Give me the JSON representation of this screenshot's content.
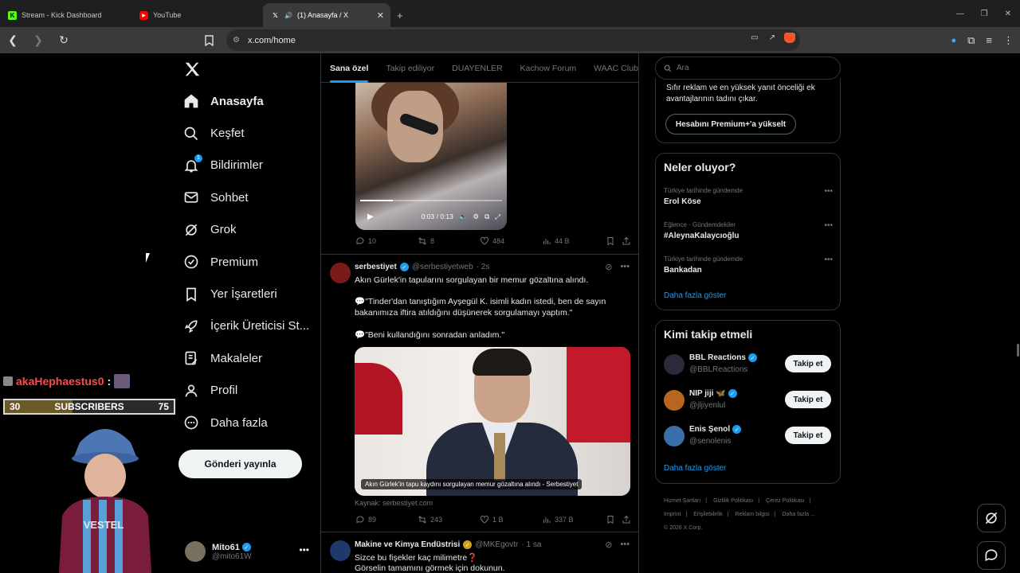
{
  "browser": {
    "tabs": [
      {
        "title": "Stream - Kick Dashboard",
        "icon": "kick-icon",
        "color": "#53fc18"
      },
      {
        "title": "YouTube",
        "icon": "youtube-icon",
        "color": "#ff0000"
      },
      {
        "title": "(1) Anasayfa / X",
        "icon": "x-icon",
        "color": "#ffffff",
        "active": true
      }
    ],
    "new_tab": "+",
    "url": "x.com/home"
  },
  "overlay": {
    "chat_user": "akaHephaestus0",
    "chat_colon": ":",
    "sub_current": "30",
    "sub_label": "SUBSCRIBERS",
    "sub_goal": "75",
    "sub_fraction": 0.4
  },
  "nav": {
    "items": [
      {
        "label": "Anasayfa",
        "icon": "home-icon",
        "active": true
      },
      {
        "label": "Keşfet",
        "icon": "search-icon"
      },
      {
        "label": "Bildirimler",
        "icon": "bell-icon",
        "badge": "1"
      },
      {
        "label": "Sohbet",
        "icon": "mail-icon"
      },
      {
        "label": "Grok",
        "icon": "grok-icon"
      },
      {
        "label": "Premium",
        "icon": "premium-icon"
      },
      {
        "label": "Yer İşaretleri",
        "icon": "bookmark-icon"
      },
      {
        "label": "İçerik Üreticisi St...",
        "icon": "rocket-icon"
      },
      {
        "label": "Makaleler",
        "icon": "article-icon"
      },
      {
        "label": "Profil",
        "icon": "person-icon"
      },
      {
        "label": "Daha fazla",
        "icon": "more-circle-icon"
      }
    ],
    "post_button": "Gönderi yayınla",
    "me": {
      "name": "Mito61",
      "handle": "@mito61W"
    }
  },
  "feed": {
    "tabs": [
      "Sana özel",
      "Takip ediliyor",
      "DUAYENLER",
      "Kachow Forum",
      "WAAC Club"
    ],
    "video": {
      "time": "0:03 / 0:13",
      "progress": 0.23
    },
    "video_actions": {
      "replies": "10",
      "reposts": "8",
      "likes": "484",
      "views": "44 B"
    },
    "post1": {
      "name": "serbestiyet",
      "handle": "@serbestiyetweb",
      "time": "· 2s",
      "line1": "Akın Gürlek'in tapularını sorgulayan bir memur gözaltına alındı.",
      "line2": "💬\"Tinder'dan tanıştığım Ayşegül K. isimli kadın istedi, ben de sayın bakanımıza iftira atıldığını düşünerek sorgulamayı yaptım.\"",
      "line3": "💬\"Beni kullandığını sonradan anladım.\"",
      "image_caption": "Akın Gürlek'in tapu kaydını sorgulayan memur gözaltına alındı - Serbestiyet",
      "source": "Kaynak: serbestiyet.com",
      "replies": "89",
      "reposts": "243",
      "likes": "1 B",
      "views": "337 B"
    },
    "post2": {
      "name": "Makine ve Kimya Endüstrisi",
      "handle": "@MKEgovtr",
      "time": "· 1 sa",
      "line1": "Sizce bu fişekler kaç milimetre❓",
      "line2": "Görselin tamamını görmek için dokunun."
    }
  },
  "right": {
    "search_placeholder": "Ara",
    "premium_text": "Sıfır reklam ve en yüksek yanıt önceliği ek avantajlarının tadını çıkar.",
    "premium_button": "Hesabını Premium+'a yükselt",
    "trends_title": "Neler oluyor?",
    "trends": [
      {
        "context": "Türkiye tarihinde gündemde",
        "topic": "Erol Köse"
      },
      {
        "context": "Eğlence · Gündemdekiler",
        "topic": "#AleynaKalaycıoğlu"
      },
      {
        "context": "Türkiye tarihinde gündemde",
        "topic": "Bankadan"
      }
    ],
    "show_more": "Daha fazla göster",
    "who_title": "Kimi takip etmeli",
    "who": [
      {
        "name": "BBL Reactions",
        "handle": "@BBLReactions",
        "button": "Takip et",
        "color": "#2a2a3a"
      },
      {
        "name": "NIP jiji 🦋",
        "handle": "@jljiyenlul",
        "button": "Takip et",
        "color": "#b8651f"
      },
      {
        "name": "Enis Şenol",
        "handle": "@senolenis",
        "button": "Takip et",
        "color": "#3a6fa8"
      }
    ],
    "footer": [
      "Hizmet Şartları",
      "|",
      "Gizlilik Politikası",
      "|",
      "Çerez Politikası",
      "|",
      "Imprint",
      "|",
      "Erişilebilirlik",
      "|",
      "Reklam bilgisi",
      "|",
      "Daha fazla ...",
      "© 2026 X Corp."
    ]
  }
}
